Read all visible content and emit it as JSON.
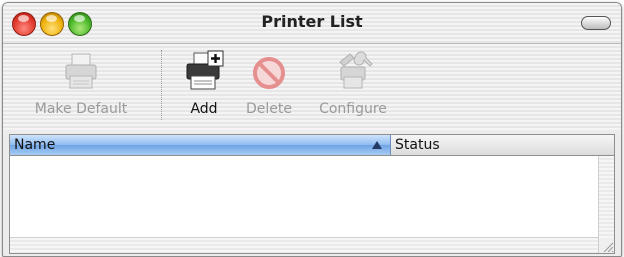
{
  "window": {
    "title": "Printer List"
  },
  "toolbar": {
    "make_default": {
      "label": "Make Default",
      "enabled": false
    },
    "add": {
      "label": "Add",
      "enabled": true
    },
    "delete": {
      "label": "Delete",
      "enabled": false
    },
    "configure": {
      "label": "Configure",
      "enabled": false
    }
  },
  "list": {
    "columns": [
      {
        "label": "Name",
        "sorted": "ascending"
      },
      {
        "label": "Status"
      }
    ],
    "rows": []
  },
  "colors": {
    "selected_header": "#8fbbf0",
    "disabled_text": "#9a9a9a"
  }
}
